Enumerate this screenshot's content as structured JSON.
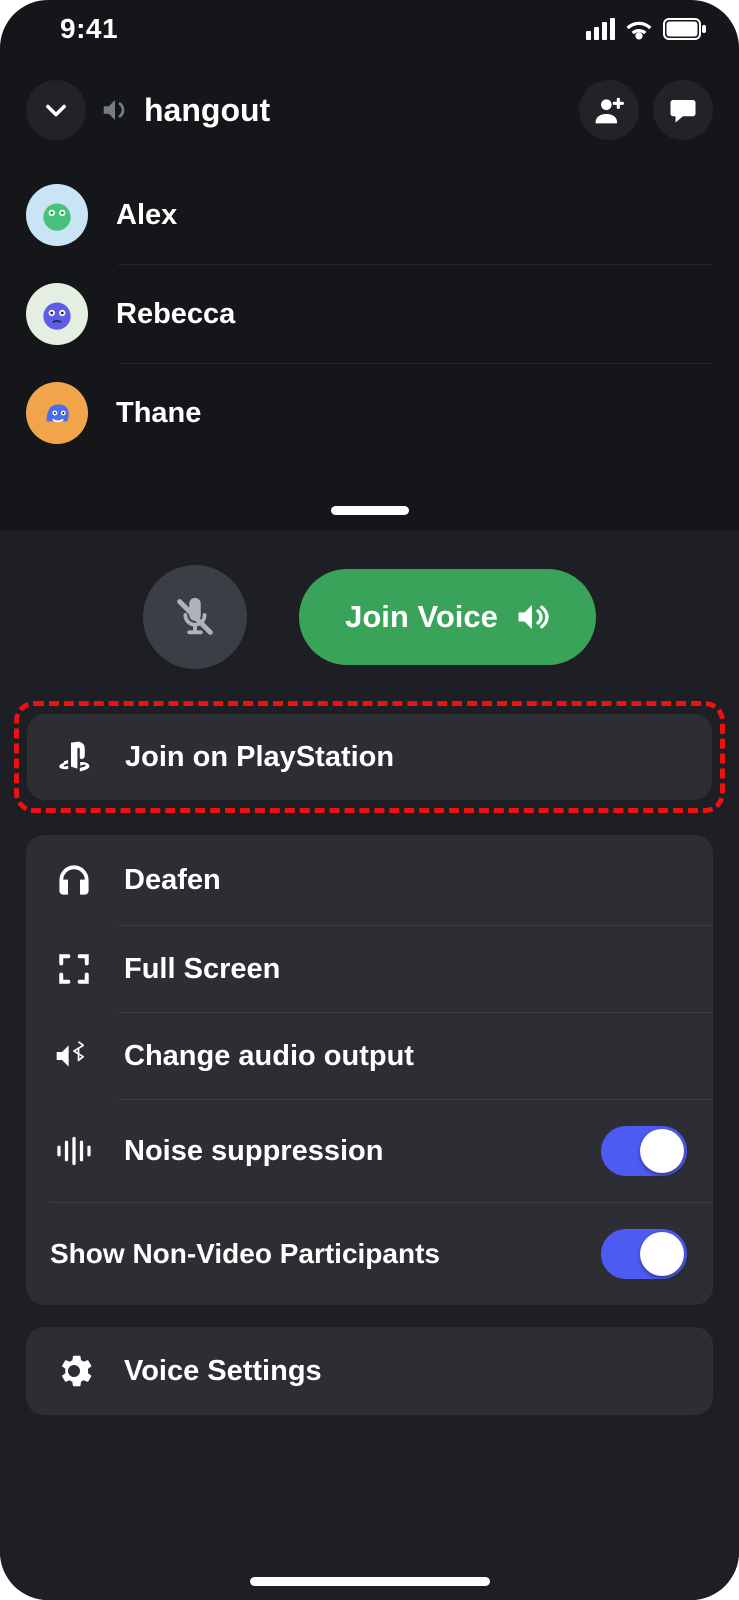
{
  "status": {
    "time": "9:41"
  },
  "header": {
    "channel_name": "hangout"
  },
  "participants": [
    {
      "name": "Alex"
    },
    {
      "name": "Rebecca"
    },
    {
      "name": "Thane"
    }
  ],
  "actions": {
    "join_voice": "Join Voice",
    "join_playstation": "Join on PlayStation"
  },
  "options": {
    "deafen": "Deafen",
    "full_screen": "Full Screen",
    "change_audio_output": "Change audio output",
    "noise_suppression": "Noise suppression",
    "show_non_video": "Show Non-Video Participants"
  },
  "settings": {
    "voice_settings": "Voice Settings"
  },
  "toggles": {
    "noise_suppression": true,
    "show_non_video": true
  }
}
